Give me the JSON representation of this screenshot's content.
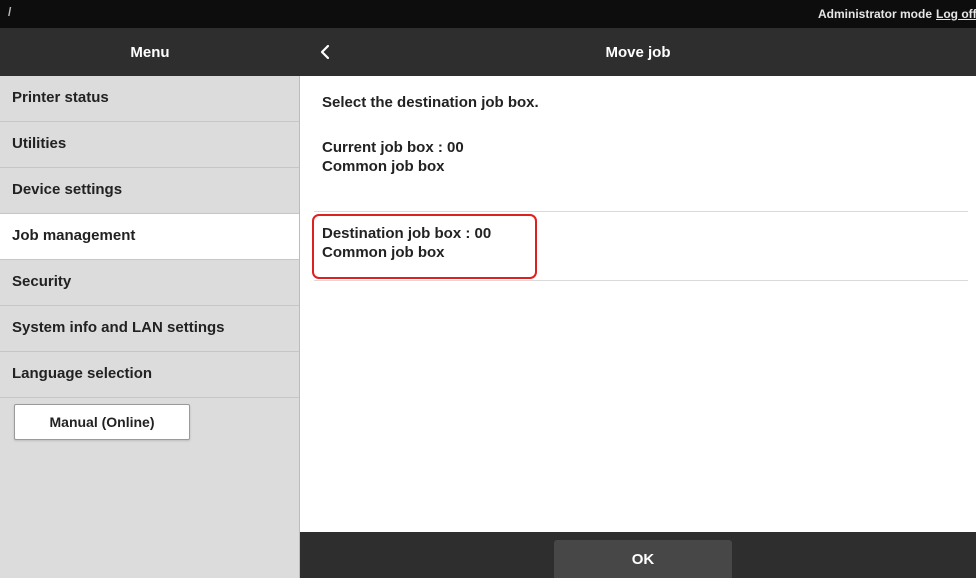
{
  "topbar": {
    "separator": "/",
    "mode_label": "Administrator mode",
    "logout_label": "Log off"
  },
  "sidebar": {
    "header": "Menu",
    "items": [
      {
        "label": "Printer status"
      },
      {
        "label": "Utilities"
      },
      {
        "label": "Device settings"
      },
      {
        "label": "Job management",
        "active": true
      },
      {
        "label": "Security"
      },
      {
        "label": "System info and LAN settings"
      },
      {
        "label": "Language selection"
      }
    ],
    "manual_button": "Manual (Online)"
  },
  "main": {
    "title": "Move job",
    "back_icon": "chevron-left-icon",
    "instruction": "Select the destination job box.",
    "current_line1": "Current job box : 00",
    "current_line2": "Common job box",
    "destination_line1": "Destination job box : 00",
    "destination_line2": "Common job box",
    "ok_label": "OK"
  },
  "colors": {
    "header_bg": "#2e2e2e",
    "topbar_bg": "#0d0d0d",
    "sidebar_bg": "#dcdcdc",
    "highlight": "#e02020"
  }
}
